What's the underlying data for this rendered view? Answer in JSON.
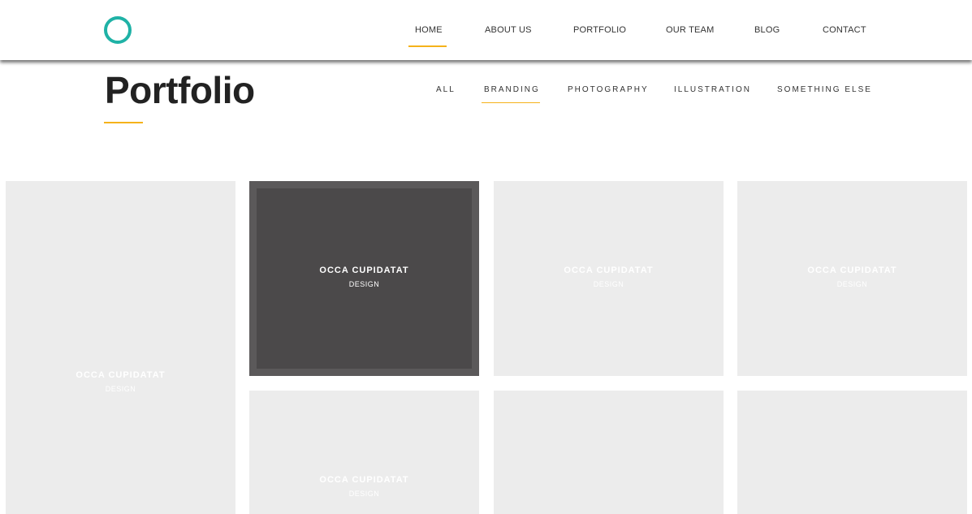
{
  "nav": {
    "items": [
      "HOME",
      "ABOUT US",
      "PORTFOLIO",
      "OUR TEAM",
      "BLOG",
      "CONTACT"
    ],
    "active_index": 0
  },
  "page": {
    "title": "Portfolio"
  },
  "filters": {
    "items": [
      "ALL",
      "BRANDING",
      "PHOTOGRAPHY",
      "ILLUSTRATION",
      "SOMETHING ELSE"
    ],
    "active_index": 1
  },
  "portfolio": {
    "items": [
      {
        "title": "OCCA CUPIDATAT",
        "category": "DESIGN"
      },
      {
        "title": "OCCA CUPIDATAT",
        "category": "DESIGN"
      },
      {
        "title": "OCCA CUPIDATAT",
        "category": "DESIGN"
      },
      {
        "title": "OCCA CUPIDATAT",
        "category": "DESIGN"
      },
      {
        "title": "OCCA CUPIDATAT",
        "category": "DESIGN"
      },
      {
        "title": "",
        "category": ""
      },
      {
        "title": "",
        "category": ""
      }
    ],
    "hovered_index": 1
  },
  "colors": {
    "accent": "#f5b21b",
    "logo_ring": "#1fb2a6",
    "tile_background": "#ececec",
    "tile_hover_outer": "#5b595a",
    "tile_hover_inner": "#4b494a",
    "text_dark": "#222222"
  }
}
